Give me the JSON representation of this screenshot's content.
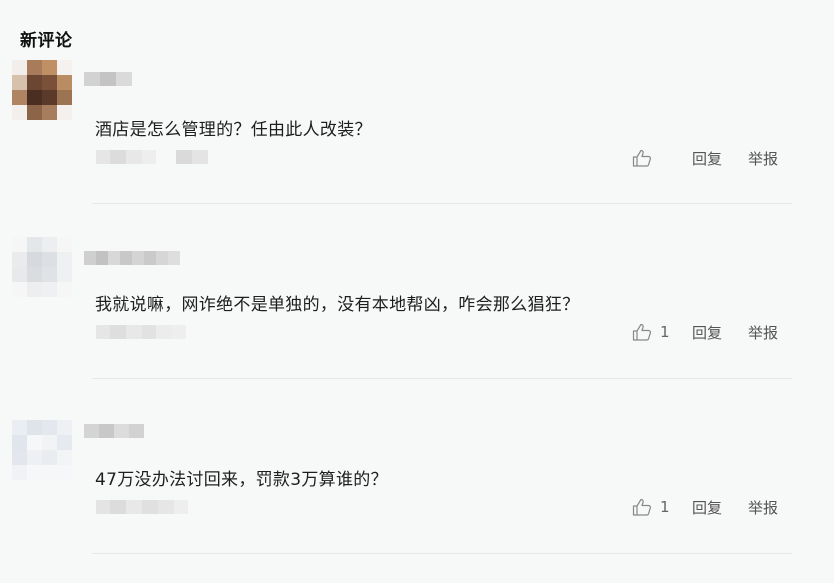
{
  "section": {
    "title": "新评论"
  },
  "comments": [
    {
      "text": "酒店是怎么管理的？任由此人改装？",
      "like_count": "",
      "reply_label": "回复",
      "report_label": "举报"
    },
    {
      "text": "我就说嘛，网诈绝不是单独的，没有本地帮凶，咋会那么猖狂？",
      "like_count": "1",
      "reply_label": "回复",
      "report_label": "举报"
    },
    {
      "text": "47万没办法讨回来，罚款3万算谁的？",
      "like_count": "1",
      "reply_label": "回复",
      "report_label": "举报"
    }
  ],
  "colors": {
    "background": "#f7f8f8",
    "text": "#1e1e1e",
    "action_text": "#555555",
    "divider": "#e6e8e8"
  },
  "icons": {
    "like": "thumbs-up-icon"
  }
}
